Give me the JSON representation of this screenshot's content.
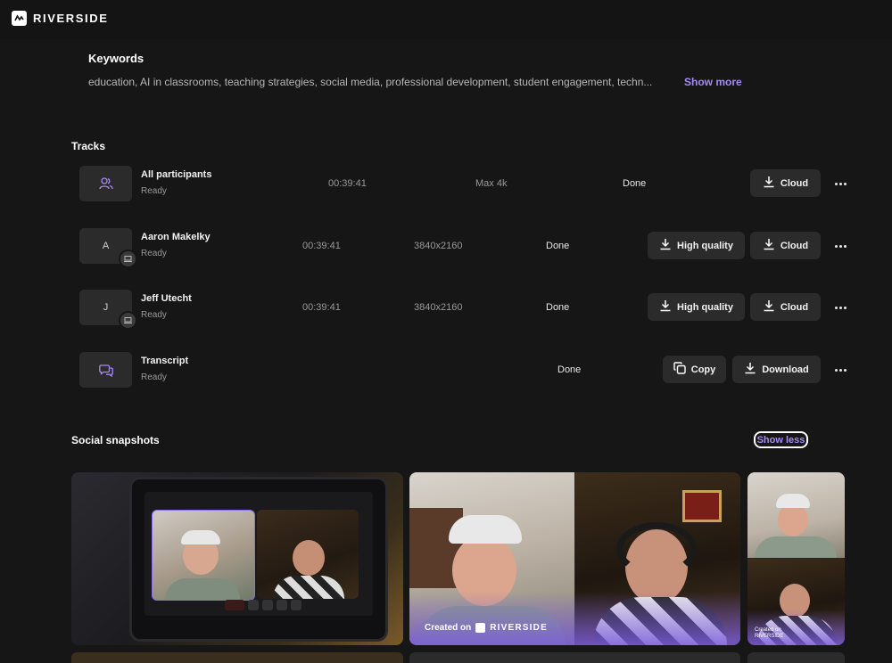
{
  "brand": {
    "name": "RIVERSIDE"
  },
  "keywords": {
    "title": "Keywords",
    "text": "education, AI in classrooms, teaching strategies, social media, professional development, student engagement, techn...",
    "show_more": "Show more"
  },
  "tracks": {
    "title": "Tracks",
    "items": [
      {
        "thumb": "participants-icon",
        "name": "All participants",
        "status": "Ready",
        "duration": "00:39:41",
        "resolution": "Max 4k",
        "state": "Done",
        "buttons": [
          "Cloud"
        ]
      },
      {
        "thumb": "A",
        "name": "Aaron Makelky",
        "status": "Ready",
        "duration": "00:39:41",
        "resolution": "3840x2160",
        "state": "Done",
        "buttons": [
          "High quality",
          "Cloud"
        ]
      },
      {
        "thumb": "J",
        "name": "Jeff Utecht",
        "status": "Ready",
        "duration": "00:39:41",
        "resolution": "3840x2160",
        "state": "Done",
        "buttons": [
          "High quality",
          "Cloud"
        ]
      },
      {
        "thumb": "transcript-icon",
        "name": "Transcript",
        "status": "Ready",
        "duration": "",
        "resolution": "",
        "state": "Done",
        "buttons": [
          "Copy",
          "Download"
        ]
      }
    ]
  },
  "social": {
    "title": "Social snapshots",
    "show_less": "Show less",
    "created_on": "Created on",
    "brand": "RIVERSIDE",
    "created_small": "Created on",
    "brand_small": "RIVERSIDE"
  },
  "colors": {
    "accent": "#a58af8",
    "background": "#161616",
    "button": "#2b2b2b"
  }
}
